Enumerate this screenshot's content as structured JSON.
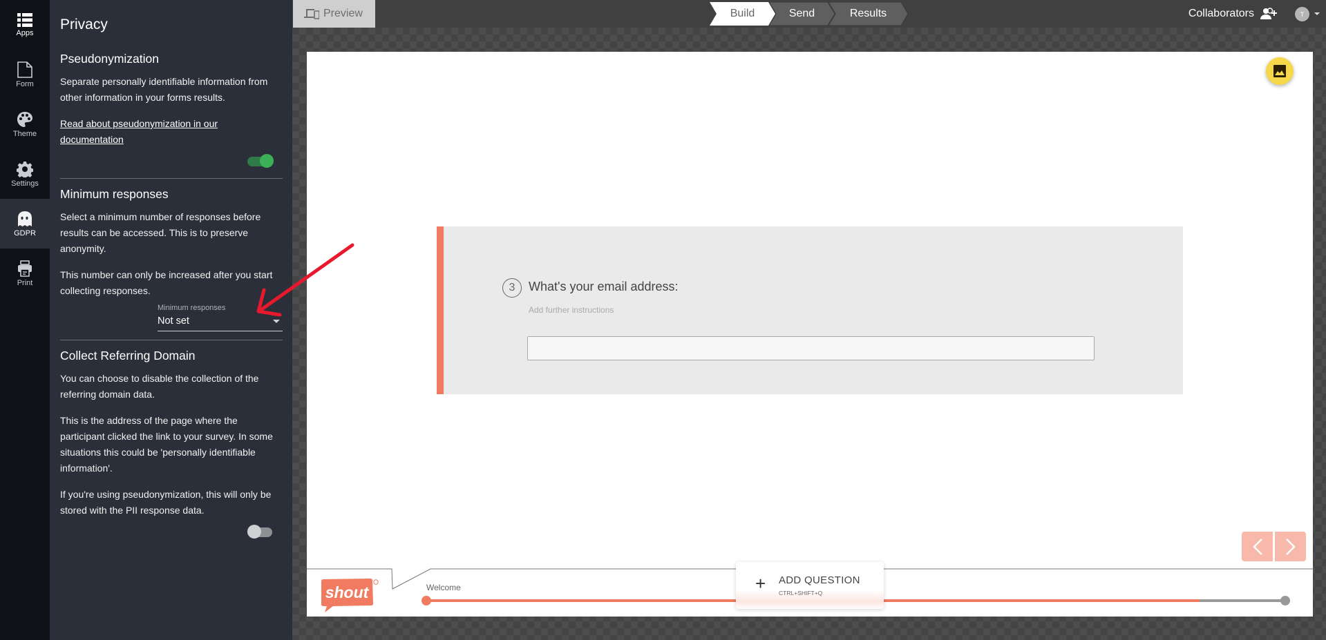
{
  "sidebar": {
    "items": [
      {
        "label": "Apps",
        "icon": "apps-grid-icon"
      },
      {
        "label": "Form",
        "icon": "document-icon"
      },
      {
        "label": "Theme",
        "icon": "palette-icon"
      },
      {
        "label": "Settings",
        "icon": "gear-icon"
      },
      {
        "label": "GDPR",
        "icon": "ghost-icon",
        "active": true
      },
      {
        "label": "Print",
        "icon": "printer-icon"
      }
    ]
  },
  "panel": {
    "title": "Privacy",
    "pseudonymization": {
      "heading": "Pseudonymization",
      "description": "Separate personally identifiable information from other information in your forms results.",
      "link": "Read about pseudonymization in our documentation",
      "enabled": true
    },
    "minimum_responses": {
      "heading": "Minimum responses",
      "description": "Select a minimum number of responses before results can be accessed. This is to preserve anonymity.",
      "note": "This number can only be increased after you start collecting responses.",
      "select_label": "Minimum responses",
      "select_value": "Not set"
    },
    "referring_domain": {
      "heading": "Collect Referring Domain",
      "description": "You can choose to disable the collection of the referring domain data.",
      "detail": "This is the address of the page where the participant clicked the link to your survey. In some situations this could be 'personally identifiable information'.",
      "note": "If you're using pseudonymization, this will only be stored with the PII response data.",
      "enabled": false
    }
  },
  "topbar": {
    "preview_label": "Preview",
    "steps": [
      {
        "label": "Build",
        "active": true
      },
      {
        "label": "Send",
        "active": false
      },
      {
        "label": "Results",
        "active": false
      }
    ],
    "collaborators_label": "Collaborators",
    "avatar_initial": "T"
  },
  "canvas": {
    "question": {
      "number": "3",
      "title": "What's your email address:",
      "instructions_placeholder": "Add further instructions",
      "answer_value": ""
    },
    "footer": {
      "logo_text": "shout",
      "welcome_label": "Welcome",
      "progress_fraction": 0.9,
      "add_question_label": "ADD QUESTION",
      "add_question_shortcut": "CTRL+SHIFT+Q"
    }
  },
  "colors": {
    "accent": "#f07b60",
    "toggle_on": "#3cb057",
    "fab": "#f7d84a",
    "annotation_arrow": "#e8192c"
  }
}
